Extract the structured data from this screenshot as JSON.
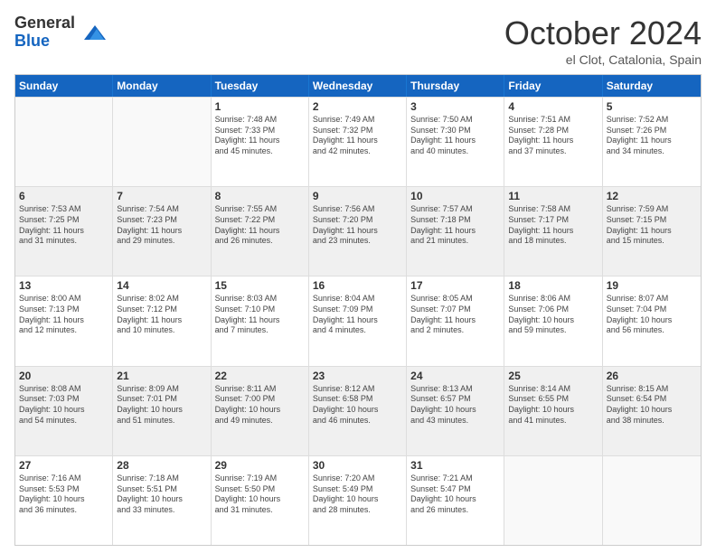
{
  "logo": {
    "general": "General",
    "blue": "Blue"
  },
  "title": "October 2024",
  "location": "el Clot, Catalonia, Spain",
  "days": [
    "Sunday",
    "Monday",
    "Tuesday",
    "Wednesday",
    "Thursday",
    "Friday",
    "Saturday"
  ],
  "rows": [
    [
      {
        "day": "",
        "empty": true,
        "lines": []
      },
      {
        "day": "",
        "empty": true,
        "lines": []
      },
      {
        "day": "1",
        "lines": [
          "Sunrise: 7:48 AM",
          "Sunset: 7:33 PM",
          "Daylight: 11 hours",
          "and 45 minutes."
        ]
      },
      {
        "day": "2",
        "lines": [
          "Sunrise: 7:49 AM",
          "Sunset: 7:32 PM",
          "Daylight: 11 hours",
          "and 42 minutes."
        ]
      },
      {
        "day": "3",
        "lines": [
          "Sunrise: 7:50 AM",
          "Sunset: 7:30 PM",
          "Daylight: 11 hours",
          "and 40 minutes."
        ]
      },
      {
        "day": "4",
        "lines": [
          "Sunrise: 7:51 AM",
          "Sunset: 7:28 PM",
          "Daylight: 11 hours",
          "and 37 minutes."
        ]
      },
      {
        "day": "5",
        "lines": [
          "Sunrise: 7:52 AM",
          "Sunset: 7:26 PM",
          "Daylight: 11 hours",
          "and 34 minutes."
        ]
      }
    ],
    [
      {
        "day": "6",
        "lines": [
          "Sunrise: 7:53 AM",
          "Sunset: 7:25 PM",
          "Daylight: 11 hours",
          "and 31 minutes."
        ]
      },
      {
        "day": "7",
        "lines": [
          "Sunrise: 7:54 AM",
          "Sunset: 7:23 PM",
          "Daylight: 11 hours",
          "and 29 minutes."
        ]
      },
      {
        "day": "8",
        "lines": [
          "Sunrise: 7:55 AM",
          "Sunset: 7:22 PM",
          "Daylight: 11 hours",
          "and 26 minutes."
        ]
      },
      {
        "day": "9",
        "lines": [
          "Sunrise: 7:56 AM",
          "Sunset: 7:20 PM",
          "Daylight: 11 hours",
          "and 23 minutes."
        ]
      },
      {
        "day": "10",
        "lines": [
          "Sunrise: 7:57 AM",
          "Sunset: 7:18 PM",
          "Daylight: 11 hours",
          "and 21 minutes."
        ]
      },
      {
        "day": "11",
        "lines": [
          "Sunrise: 7:58 AM",
          "Sunset: 7:17 PM",
          "Daylight: 11 hours",
          "and 18 minutes."
        ]
      },
      {
        "day": "12",
        "lines": [
          "Sunrise: 7:59 AM",
          "Sunset: 7:15 PM",
          "Daylight: 11 hours",
          "and 15 minutes."
        ]
      }
    ],
    [
      {
        "day": "13",
        "lines": [
          "Sunrise: 8:00 AM",
          "Sunset: 7:13 PM",
          "Daylight: 11 hours",
          "and 12 minutes."
        ]
      },
      {
        "day": "14",
        "lines": [
          "Sunrise: 8:02 AM",
          "Sunset: 7:12 PM",
          "Daylight: 11 hours",
          "and 10 minutes."
        ]
      },
      {
        "day": "15",
        "lines": [
          "Sunrise: 8:03 AM",
          "Sunset: 7:10 PM",
          "Daylight: 11 hours",
          "and 7 minutes."
        ]
      },
      {
        "day": "16",
        "lines": [
          "Sunrise: 8:04 AM",
          "Sunset: 7:09 PM",
          "Daylight: 11 hours",
          "and 4 minutes."
        ]
      },
      {
        "day": "17",
        "lines": [
          "Sunrise: 8:05 AM",
          "Sunset: 7:07 PM",
          "Daylight: 11 hours",
          "and 2 minutes."
        ]
      },
      {
        "day": "18",
        "lines": [
          "Sunrise: 8:06 AM",
          "Sunset: 7:06 PM",
          "Daylight: 10 hours",
          "and 59 minutes."
        ]
      },
      {
        "day": "19",
        "lines": [
          "Sunrise: 8:07 AM",
          "Sunset: 7:04 PM",
          "Daylight: 10 hours",
          "and 56 minutes."
        ]
      }
    ],
    [
      {
        "day": "20",
        "lines": [
          "Sunrise: 8:08 AM",
          "Sunset: 7:03 PM",
          "Daylight: 10 hours",
          "and 54 minutes."
        ]
      },
      {
        "day": "21",
        "lines": [
          "Sunrise: 8:09 AM",
          "Sunset: 7:01 PM",
          "Daylight: 10 hours",
          "and 51 minutes."
        ]
      },
      {
        "day": "22",
        "lines": [
          "Sunrise: 8:11 AM",
          "Sunset: 7:00 PM",
          "Daylight: 10 hours",
          "and 49 minutes."
        ]
      },
      {
        "day": "23",
        "lines": [
          "Sunrise: 8:12 AM",
          "Sunset: 6:58 PM",
          "Daylight: 10 hours",
          "and 46 minutes."
        ]
      },
      {
        "day": "24",
        "lines": [
          "Sunrise: 8:13 AM",
          "Sunset: 6:57 PM",
          "Daylight: 10 hours",
          "and 43 minutes."
        ]
      },
      {
        "day": "25",
        "lines": [
          "Sunrise: 8:14 AM",
          "Sunset: 6:55 PM",
          "Daylight: 10 hours",
          "and 41 minutes."
        ]
      },
      {
        "day": "26",
        "lines": [
          "Sunrise: 8:15 AM",
          "Sunset: 6:54 PM",
          "Daylight: 10 hours",
          "and 38 minutes."
        ]
      }
    ],
    [
      {
        "day": "27",
        "lines": [
          "Sunrise: 7:16 AM",
          "Sunset: 5:53 PM",
          "Daylight: 10 hours",
          "and 36 minutes."
        ]
      },
      {
        "day": "28",
        "lines": [
          "Sunrise: 7:18 AM",
          "Sunset: 5:51 PM",
          "Daylight: 10 hours",
          "and 33 minutes."
        ]
      },
      {
        "day": "29",
        "lines": [
          "Sunrise: 7:19 AM",
          "Sunset: 5:50 PM",
          "Daylight: 10 hours",
          "and 31 minutes."
        ]
      },
      {
        "day": "30",
        "lines": [
          "Sunrise: 7:20 AM",
          "Sunset: 5:49 PM",
          "Daylight: 10 hours",
          "and 28 minutes."
        ]
      },
      {
        "day": "31",
        "lines": [
          "Sunrise: 7:21 AM",
          "Sunset: 5:47 PM",
          "Daylight: 10 hours",
          "and 26 minutes."
        ]
      },
      {
        "day": "",
        "empty": true,
        "lines": []
      },
      {
        "day": "",
        "empty": true,
        "lines": []
      }
    ]
  ]
}
